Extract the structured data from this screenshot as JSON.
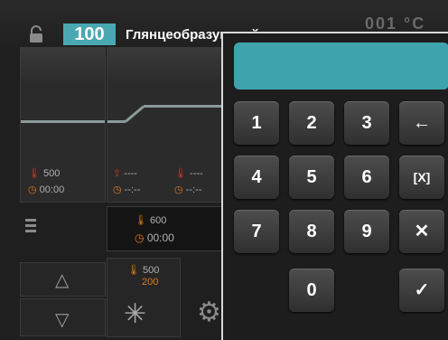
{
  "header": {
    "program_number": "100",
    "program_name": "Глянцеобразующий",
    "right_text": "001 °C"
  },
  "panels": {
    "left_temp": "500",
    "left_time": "00:00",
    "mid_temp_a": "----",
    "mid_time_a": "--:--",
    "mid_temp_b": "----",
    "mid_time_b": "--:--",
    "hold_temp": "600",
    "hold_time": "00:00",
    "lower_temp_top": "500",
    "lower_temp_bottom": "200"
  },
  "keypad": {
    "display_value": "",
    "keys": [
      "1",
      "2",
      "3",
      "←",
      "4",
      "5",
      "6",
      "[X]",
      "7",
      "8",
      "9",
      "✕",
      "0",
      "✓"
    ]
  }
}
